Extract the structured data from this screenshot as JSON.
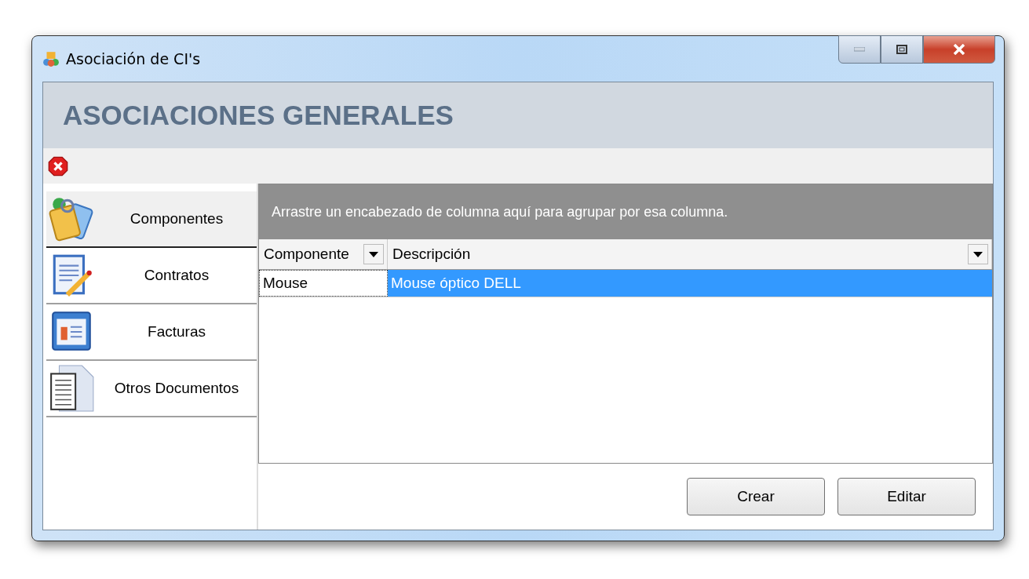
{
  "window": {
    "title": "Asociación de CI's"
  },
  "header": {
    "title": "ASOCIACIONES GENERALES"
  },
  "sidebar": {
    "items": [
      {
        "label": "Componentes",
        "kind": "tags",
        "selected": true
      },
      {
        "label": "Contratos",
        "kind": "contract",
        "selected": false
      },
      {
        "label": "Facturas",
        "kind": "invoice",
        "selected": false
      },
      {
        "label": "Otros Documentos",
        "kind": "document",
        "selected": false
      }
    ]
  },
  "grid": {
    "group_panel_text": "Arrastre un encabezado de columna aquí para agrupar por esa columna.",
    "columns": [
      {
        "label": "Componente"
      },
      {
        "label": "Descripción"
      }
    ],
    "rows": [
      {
        "cells": [
          "Mouse",
          "Mouse óptico DELL"
        ],
        "selected": true
      }
    ]
  },
  "buttons": [
    {
      "label": "Crear"
    },
    {
      "label": "Editar"
    }
  ]
}
